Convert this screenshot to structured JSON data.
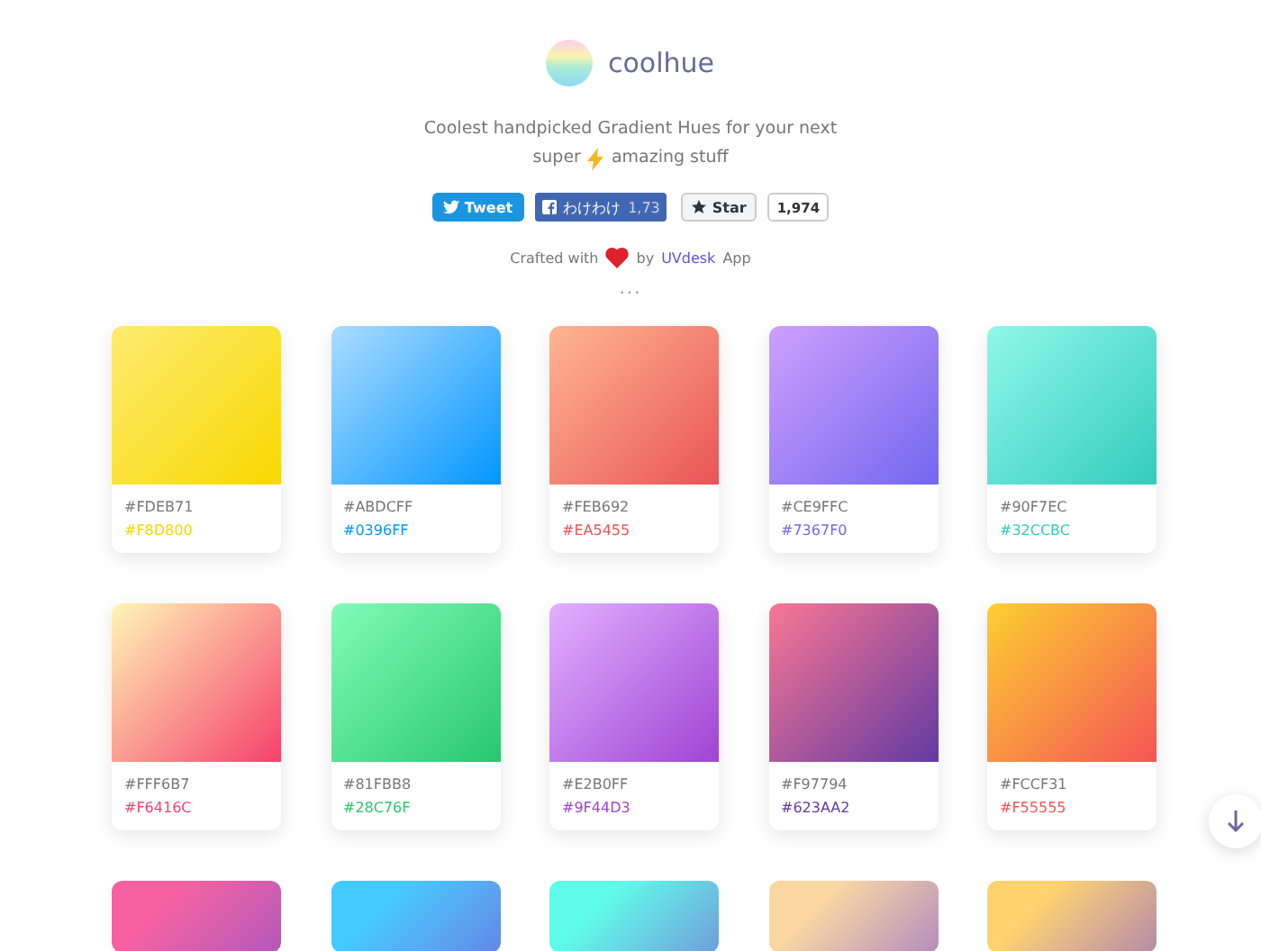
{
  "header": {
    "title": "coolhue",
    "tagline_1": "Coolest handpicked Gradient Hues for your next",
    "tagline_2a": "super",
    "tagline_2b": "amazing stuff"
  },
  "social": {
    "tweet": "Tweet",
    "facebook": "わけわけ",
    "facebook_count": "1,73",
    "star": "Star",
    "star_count": "1,974"
  },
  "credit": {
    "prefix": "Crafted with",
    "by": "by",
    "link": "UVdesk",
    "suffix": "App"
  },
  "divider": "...",
  "cards": [
    {
      "start": "#FDEB71",
      "end": "#F8D800"
    },
    {
      "start": "#ABDCFF",
      "end": "#0396FF"
    },
    {
      "start": "#FEB692",
      "end": "#EA5455"
    },
    {
      "start": "#CE9FFC",
      "end": "#7367F0"
    },
    {
      "start": "#90F7EC",
      "end": "#32CCBC"
    },
    {
      "start": "#FFF6B7",
      "end": "#F6416C"
    },
    {
      "start": "#81FBB8",
      "end": "#28C76F"
    },
    {
      "start": "#E2B0FF",
      "end": "#9F44D3"
    },
    {
      "start": "#F97794",
      "end": "#623AA2"
    },
    {
      "start": "#FCCF31",
      "end": "#F55555"
    }
  ],
  "partial_cards": [
    {
      "color": "#F761A1"
    },
    {
      "color": "#43CBFF"
    },
    {
      "color": "#5EFCE8"
    },
    {
      "color": "#FAD7A1"
    },
    {
      "color": "#FFD26F"
    }
  ]
}
